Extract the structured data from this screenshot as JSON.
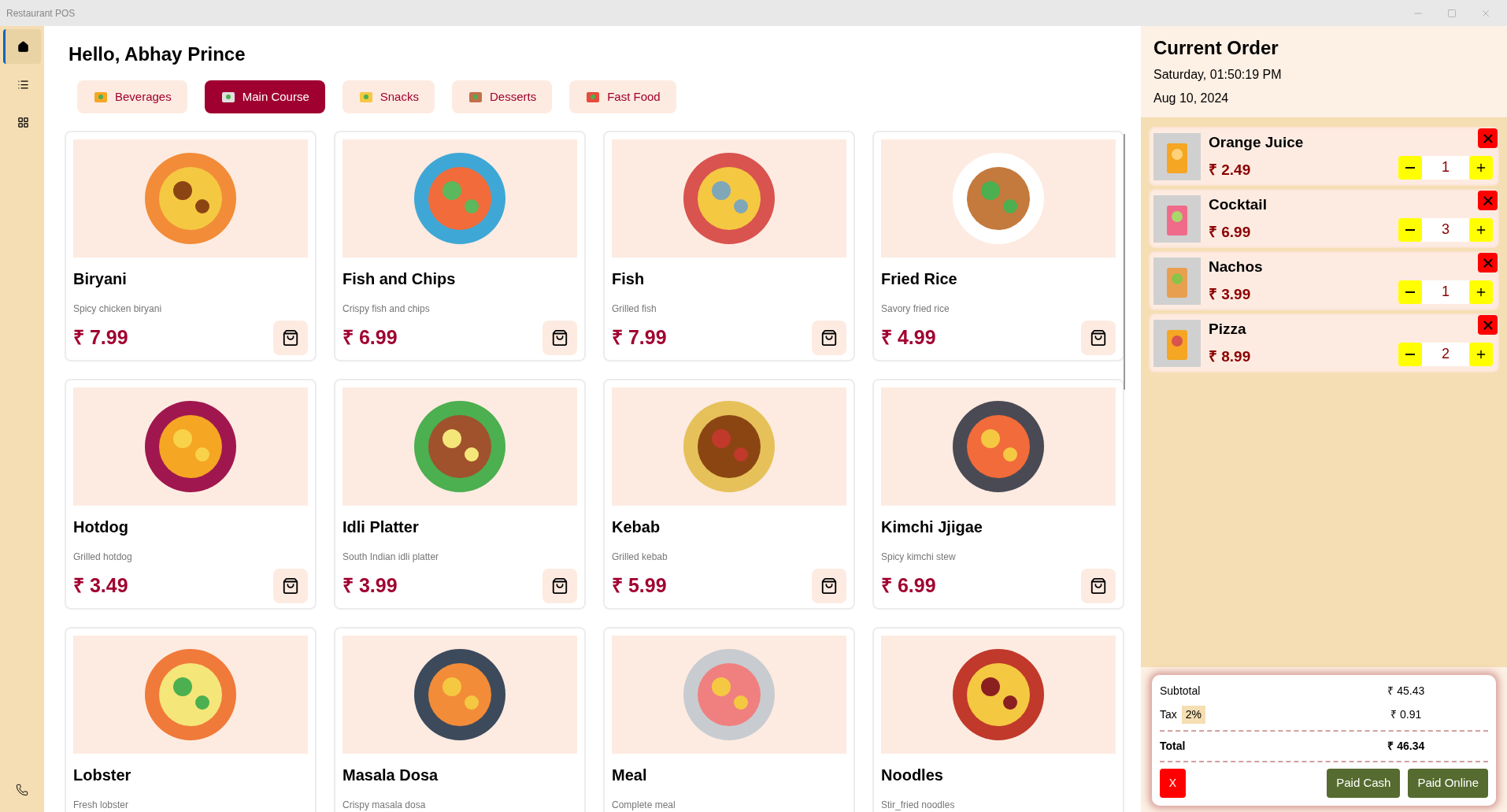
{
  "window": {
    "title": "Restaurant POS"
  },
  "sidebar": {
    "items": [
      {
        "selected": true
      },
      {
        "selected": false
      },
      {
        "selected": false
      }
    ]
  },
  "greeting": "Hello, Abhay Prince",
  "categories": [
    {
      "label": "Beverages",
      "selected": false
    },
    {
      "label": "Main Course",
      "selected": true
    },
    {
      "label": "Snacks",
      "selected": false
    },
    {
      "label": "Desserts",
      "selected": false
    },
    {
      "label": "Fast Food",
      "selected": false
    }
  ],
  "menu_items": [
    {
      "name": "Biryani",
      "description": "Spicy chicken biryani",
      "price": "₹ 7.99"
    },
    {
      "name": "Fish and Chips",
      "description": "Crispy fish and chips",
      "price": "₹ 6.99"
    },
    {
      "name": "Fish",
      "description": "Grilled fish",
      "price": "₹ 7.99"
    },
    {
      "name": "Fried Rice",
      "description": "Savory fried rice",
      "price": "₹ 4.99"
    },
    {
      "name": "Hotdog",
      "description": "Grilled hotdog",
      "price": "₹ 3.49"
    },
    {
      "name": "Idli Platter",
      "description": "South Indian idli platter",
      "price": "₹ 3.99"
    },
    {
      "name": "Kebab",
      "description": "Grilled kebab",
      "price": "₹ 5.99"
    },
    {
      "name": "Kimchi Jjigae",
      "description": "Spicy kimchi stew",
      "price": "₹ 6.99"
    },
    {
      "name": "Lobster",
      "description": "Fresh lobster"
    },
    {
      "name": "Masala Dosa",
      "description": "Crispy masala dosa"
    },
    {
      "name": "Meal",
      "description": "Complete meal"
    },
    {
      "name": "Noodles",
      "description": "Stir_fried noodles"
    }
  ],
  "order": {
    "title": "Current Order",
    "day_time": "Saturday, 01:50:19 PM",
    "date": "Aug 10, 2024",
    "items": [
      {
        "name": "Orange Juice",
        "price": "₹ 2.49",
        "quantity": "1"
      },
      {
        "name": "Cocktail",
        "price": "₹ 6.99",
        "quantity": "3"
      },
      {
        "name": "Nachos",
        "price": "₹ 3.99",
        "quantity": "1"
      },
      {
        "name": "Pizza",
        "price": "₹ 8.99",
        "quantity": "2"
      }
    ],
    "summary": {
      "subtotal_label": "Subtotal",
      "subtotal": "₹ 45.43",
      "tax_label": "Tax",
      "tax_rate": "2%",
      "tax": "₹ 0.91",
      "total_label": "Total",
      "total": "₹ 46.34"
    },
    "buttons": {
      "cancel": "X",
      "paid_cash": "Paid Cash",
      "paid_online": "Paid Online"
    }
  }
}
